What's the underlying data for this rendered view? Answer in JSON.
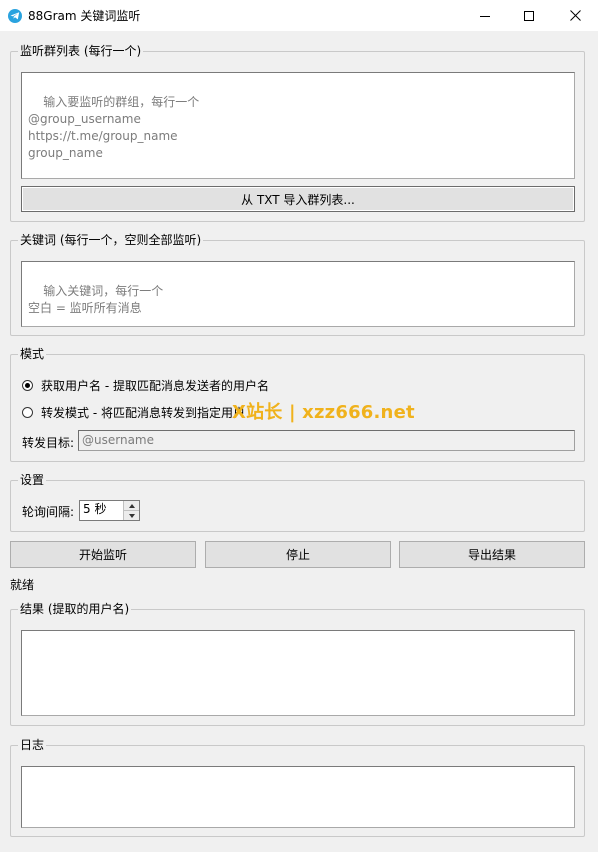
{
  "window": {
    "title": "88Gram 关键词监听",
    "controls": {
      "minimize_icon": "minimize-icon",
      "maximize_icon": "maximize-icon",
      "close_icon": "close-icon"
    }
  },
  "groups": {
    "title": "监听群列表 (每行一个)",
    "placeholder": "输入要监听的群组，每行一个\n@group_username\nhttps://t.me/group_name\ngroup_name",
    "value": "",
    "import_button": "从 TXT 导入群列表..."
  },
  "keywords": {
    "title": "关键词 (每行一个，空则全部监听)",
    "placeholder": "输入关键词，每行一个\n空白 = 监听所有消息",
    "value": ""
  },
  "mode": {
    "title": "模式",
    "options": [
      {
        "label": "获取用户名 - 提取匹配消息发送者的用户名",
        "checked": true
      },
      {
        "label": "转发模式 - 将匹配消息转发到指定用户",
        "checked": false
      }
    ],
    "forward_target_label": "转发目标:",
    "forward_target_placeholder": "@username",
    "forward_target_value": ""
  },
  "settings": {
    "title": "设置",
    "poll_interval_label": "轮询间隔:",
    "poll_interval_value": "5 秒"
  },
  "actions": {
    "start": "开始监听",
    "stop": "停止",
    "export": "导出结果"
  },
  "status": "就绪",
  "results": {
    "title": "结果 (提取的用户名)",
    "value": ""
  },
  "log": {
    "title": "日志",
    "value": ""
  },
  "watermark": "X站长 | xzz666.net",
  "colors": {
    "telegram_blue": "#2aa3df",
    "watermark": "#f0b21c"
  }
}
